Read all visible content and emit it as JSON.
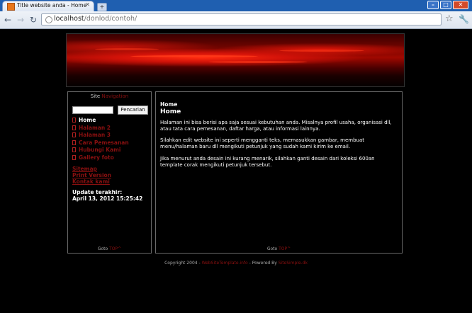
{
  "browser": {
    "tab_title": "Title website anda - Home",
    "url_host": "localhost",
    "url_path": "/donlod/contoh/",
    "icons": {
      "back": "back-arrow-icon",
      "forward": "forward-arrow-icon",
      "reload": "reload-icon",
      "bookmark": "star-icon",
      "menu": "wrench-icon"
    }
  },
  "sidebar": {
    "heading_site": "Site",
    "heading_nav": "Navigation",
    "search_button": "Pencarian",
    "search_value": "",
    "items": [
      {
        "label": "Home"
      },
      {
        "label": "Halaman 2"
      },
      {
        "label": "Halaman 3"
      },
      {
        "label": "Cara Pemesanan"
      },
      {
        "label": "Hubungi Kami"
      },
      {
        "label": "Gallery foto"
      }
    ],
    "links": [
      "Sitemap",
      "Print Version",
      "Kontak kami"
    ],
    "update_label": "Update terakhir:",
    "update_value": "April 13, 2012 15:25:42",
    "goto_text": "Goto",
    "goto_link": "TOP^"
  },
  "main": {
    "breadcrumb": "Home",
    "title": "Home",
    "paragraphs": [
      "Halaman ini bisa berisi apa saja sesuai kebutuhan anda. Misalnya profil usaha, organisasi dll, atau tata cara pemesanan, daftar harga, atau informasi lainnya.",
      "Silahkan edit website ini seperti mengganti teks, memasukkan gambar, membuat menu/halaman baru dll mengikuti petunjuk yang sudah kami kirim ke email.",
      "Jika menurut anda desain ini kurang menarik, silahkan ganti desain dari koleksi 600an template corak mengikuti petunjuk tersebut."
    ],
    "goto_text": "Goto",
    "goto_link": "TOP^"
  },
  "footer": {
    "copyright": "Copyright 2004 -",
    "site_link": "WebSiteTemplate.info",
    "powered": "- Powered By",
    "powered_link": "SiteSimple.dk"
  },
  "colors": {
    "accent_red": "#8a1010",
    "background": "#000000",
    "text": "#ffffff"
  }
}
